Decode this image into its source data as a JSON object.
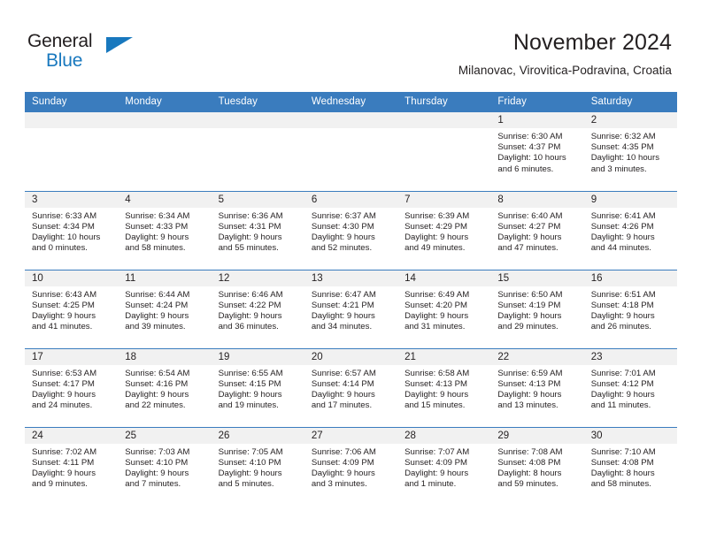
{
  "brand": {
    "name_part1": "General",
    "name_part2": "Blue",
    "triangle_icon": "triangle-icon",
    "accent_color": "#1878be"
  },
  "header": {
    "title": "November 2024",
    "location": "Milanovac, Virovitica-Podravina, Croatia"
  },
  "theme": {
    "header_blue": "#3a7cbe",
    "daynum_band": "#f1f1f1",
    "text": "#231f20"
  },
  "calendar": {
    "weekday_headers": [
      "Sunday",
      "Monday",
      "Tuesday",
      "Wednesday",
      "Thursday",
      "Friday",
      "Saturday"
    ],
    "weeks": [
      [
        {
          "day": "",
          "lines": []
        },
        {
          "day": "",
          "lines": []
        },
        {
          "day": "",
          "lines": []
        },
        {
          "day": "",
          "lines": []
        },
        {
          "day": "",
          "lines": []
        },
        {
          "day": "1",
          "lines": [
            "Sunrise: 6:30 AM",
            "Sunset: 4:37 PM",
            "Daylight: 10 hours",
            "and 6 minutes."
          ]
        },
        {
          "day": "2",
          "lines": [
            "Sunrise: 6:32 AM",
            "Sunset: 4:35 PM",
            "Daylight: 10 hours",
            "and 3 minutes."
          ]
        }
      ],
      [
        {
          "day": "3",
          "lines": [
            "Sunrise: 6:33 AM",
            "Sunset: 4:34 PM",
            "Daylight: 10 hours",
            "and 0 minutes."
          ]
        },
        {
          "day": "4",
          "lines": [
            "Sunrise: 6:34 AM",
            "Sunset: 4:33 PM",
            "Daylight: 9 hours",
            "and 58 minutes."
          ]
        },
        {
          "day": "5",
          "lines": [
            "Sunrise: 6:36 AM",
            "Sunset: 4:31 PM",
            "Daylight: 9 hours",
            "and 55 minutes."
          ]
        },
        {
          "day": "6",
          "lines": [
            "Sunrise: 6:37 AM",
            "Sunset: 4:30 PM",
            "Daylight: 9 hours",
            "and 52 minutes."
          ]
        },
        {
          "day": "7",
          "lines": [
            "Sunrise: 6:39 AM",
            "Sunset: 4:29 PM",
            "Daylight: 9 hours",
            "and 49 minutes."
          ]
        },
        {
          "day": "8",
          "lines": [
            "Sunrise: 6:40 AM",
            "Sunset: 4:27 PM",
            "Daylight: 9 hours",
            "and 47 minutes."
          ]
        },
        {
          "day": "9",
          "lines": [
            "Sunrise: 6:41 AM",
            "Sunset: 4:26 PM",
            "Daylight: 9 hours",
            "and 44 minutes."
          ]
        }
      ],
      [
        {
          "day": "10",
          "lines": [
            "Sunrise: 6:43 AM",
            "Sunset: 4:25 PM",
            "Daylight: 9 hours",
            "and 41 minutes."
          ]
        },
        {
          "day": "11",
          "lines": [
            "Sunrise: 6:44 AM",
            "Sunset: 4:24 PM",
            "Daylight: 9 hours",
            "and 39 minutes."
          ]
        },
        {
          "day": "12",
          "lines": [
            "Sunrise: 6:46 AM",
            "Sunset: 4:22 PM",
            "Daylight: 9 hours",
            "and 36 minutes."
          ]
        },
        {
          "day": "13",
          "lines": [
            "Sunrise: 6:47 AM",
            "Sunset: 4:21 PM",
            "Daylight: 9 hours",
            "and 34 minutes."
          ]
        },
        {
          "day": "14",
          "lines": [
            "Sunrise: 6:49 AM",
            "Sunset: 4:20 PM",
            "Daylight: 9 hours",
            "and 31 minutes."
          ]
        },
        {
          "day": "15",
          "lines": [
            "Sunrise: 6:50 AM",
            "Sunset: 4:19 PM",
            "Daylight: 9 hours",
            "and 29 minutes."
          ]
        },
        {
          "day": "16",
          "lines": [
            "Sunrise: 6:51 AM",
            "Sunset: 4:18 PM",
            "Daylight: 9 hours",
            "and 26 minutes."
          ]
        }
      ],
      [
        {
          "day": "17",
          "lines": [
            "Sunrise: 6:53 AM",
            "Sunset: 4:17 PM",
            "Daylight: 9 hours",
            "and 24 minutes."
          ]
        },
        {
          "day": "18",
          "lines": [
            "Sunrise: 6:54 AM",
            "Sunset: 4:16 PM",
            "Daylight: 9 hours",
            "and 22 minutes."
          ]
        },
        {
          "day": "19",
          "lines": [
            "Sunrise: 6:55 AM",
            "Sunset: 4:15 PM",
            "Daylight: 9 hours",
            "and 19 minutes."
          ]
        },
        {
          "day": "20",
          "lines": [
            "Sunrise: 6:57 AM",
            "Sunset: 4:14 PM",
            "Daylight: 9 hours",
            "and 17 minutes."
          ]
        },
        {
          "day": "21",
          "lines": [
            "Sunrise: 6:58 AM",
            "Sunset: 4:13 PM",
            "Daylight: 9 hours",
            "and 15 minutes."
          ]
        },
        {
          "day": "22",
          "lines": [
            "Sunrise: 6:59 AM",
            "Sunset: 4:13 PM",
            "Daylight: 9 hours",
            "and 13 minutes."
          ]
        },
        {
          "day": "23",
          "lines": [
            "Sunrise: 7:01 AM",
            "Sunset: 4:12 PM",
            "Daylight: 9 hours",
            "and 11 minutes."
          ]
        }
      ],
      [
        {
          "day": "24",
          "lines": [
            "Sunrise: 7:02 AM",
            "Sunset: 4:11 PM",
            "Daylight: 9 hours",
            "and 9 minutes."
          ]
        },
        {
          "day": "25",
          "lines": [
            "Sunrise: 7:03 AM",
            "Sunset: 4:10 PM",
            "Daylight: 9 hours",
            "and 7 minutes."
          ]
        },
        {
          "day": "26",
          "lines": [
            "Sunrise: 7:05 AM",
            "Sunset: 4:10 PM",
            "Daylight: 9 hours",
            "and 5 minutes."
          ]
        },
        {
          "day": "27",
          "lines": [
            "Sunrise: 7:06 AM",
            "Sunset: 4:09 PM",
            "Daylight: 9 hours",
            "and 3 minutes."
          ]
        },
        {
          "day": "28",
          "lines": [
            "Sunrise: 7:07 AM",
            "Sunset: 4:09 PM",
            "Daylight: 9 hours",
            "and 1 minute."
          ]
        },
        {
          "day": "29",
          "lines": [
            "Sunrise: 7:08 AM",
            "Sunset: 4:08 PM",
            "Daylight: 8 hours",
            "and 59 minutes."
          ]
        },
        {
          "day": "30",
          "lines": [
            "Sunrise: 7:10 AM",
            "Sunset: 4:08 PM",
            "Daylight: 8 hours",
            "and 58 minutes."
          ]
        }
      ]
    ]
  }
}
